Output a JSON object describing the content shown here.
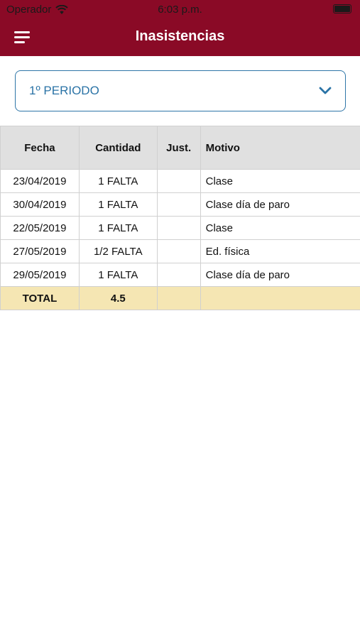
{
  "status_bar": {
    "carrier": "Operador",
    "time": "6:03 p.m."
  },
  "header": {
    "title": "Inasistencias"
  },
  "period_select": {
    "selected": "1º PERIODO"
  },
  "table": {
    "columns": [
      "Fecha",
      "Cantidad",
      "Just.",
      "Motivo"
    ],
    "rows": [
      {
        "fecha": "23/04/2019",
        "cantidad": "1 FALTA",
        "just": "",
        "motivo": "Clase"
      },
      {
        "fecha": "30/04/2019",
        "cantidad": "1 FALTA",
        "just": "",
        "motivo": "Clase día de paro"
      },
      {
        "fecha": "22/05/2019",
        "cantidad": "1 FALTA",
        "just": "",
        "motivo": "Clase"
      },
      {
        "fecha": "27/05/2019",
        "cantidad": "1/2 FALTA",
        "just": "",
        "motivo": "Ed. física"
      },
      {
        "fecha": "29/05/2019",
        "cantidad": "1 FALTA",
        "just": "",
        "motivo": "Clase día de paro"
      }
    ],
    "total": {
      "label": "TOTAL",
      "cantidad": "4.5",
      "just": "",
      "motivo": ""
    }
  },
  "colors": {
    "header_bg": "#8a0a26",
    "accent_blue": "#2a73a6",
    "total_row_bg": "#f5e6b3",
    "table_header_bg": "#e0e0e0"
  },
  "icons": {
    "menu": "hamburger-menu-icon",
    "dropdown": "chevron-down-icon",
    "wifi": "wifi-icon",
    "battery": "battery-icon"
  }
}
